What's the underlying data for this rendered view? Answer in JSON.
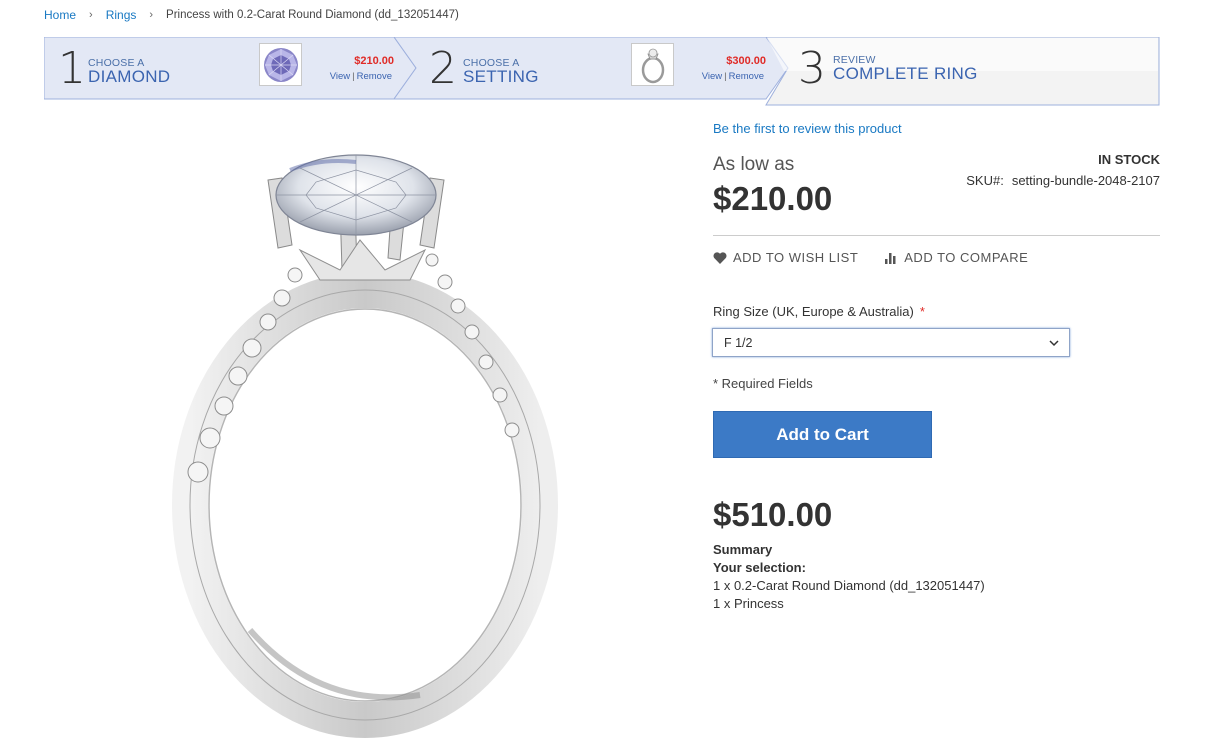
{
  "breadcrumb": {
    "home": "Home",
    "rings": "Rings",
    "current": "Princess with 0.2-Carat Round Diamond (dd_132051447)"
  },
  "steps": [
    {
      "number": "1",
      "sub": "CHOOSE A",
      "main": "DIAMOND",
      "price": "$210.00",
      "view": "View",
      "remove": "Remove"
    },
    {
      "number": "2",
      "sub": "CHOOSE A",
      "main": "SETTING",
      "price": "$300.00",
      "view": "View",
      "remove": "Remove"
    },
    {
      "number": "3",
      "sub": "REVIEW",
      "main": "COMPLETE RING"
    }
  ],
  "product": {
    "review_link": "Be the first to review this product",
    "as_low_as": "As low as",
    "price": "$210.00",
    "stock": "IN STOCK",
    "sku_label": "SKU#:",
    "sku": "setting-bundle-2048-2107",
    "wishlist": "ADD TO WISH LIST",
    "compare": "ADD TO COMPARE",
    "ring_size_label": "Ring Size (UK, Europe & Australia)",
    "required_mark": "*",
    "ring_size_value": "F 1/2",
    "required_fields": "* Required Fields",
    "add_to_cart": "Add to Cart",
    "total": "$510.00",
    "summary_title": "Summary",
    "selection_title": "Your selection:",
    "selection_items": [
      "1 x 0.2-Carat Round Diamond (dd_132051447)",
      "1 x Princess"
    ]
  },
  "colors": {
    "accent": "#1979c3",
    "button": "#3c7ac6",
    "step_bg": "#e3e8f5",
    "step_border": "#9eb0dd",
    "price_red": "#e02b27"
  }
}
